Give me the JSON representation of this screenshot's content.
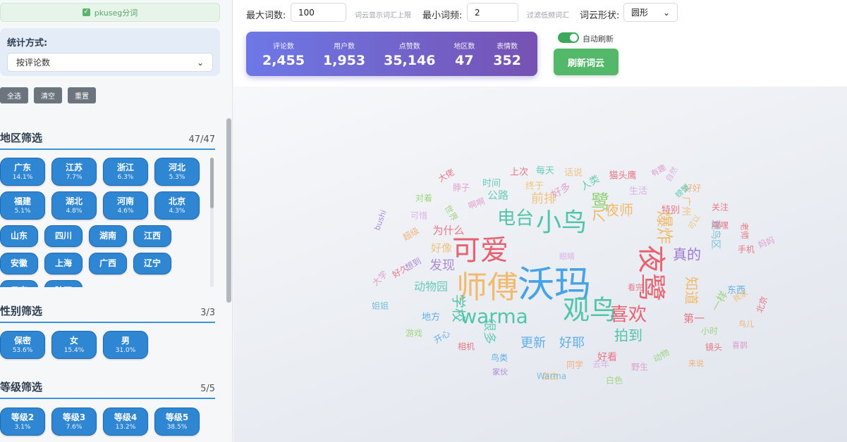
{
  "sidebar": {
    "segmenter_label": "pkuseg分词",
    "stat_label": "统计方式:",
    "stat_value": "按评论数",
    "buttons": {
      "select_all": "全选",
      "clear": "清空",
      "reset": "重置"
    },
    "region": {
      "title": "地区筛选",
      "count": "47/47",
      "items": [
        {
          "name": "广东",
          "pct": "14.1%"
        },
        {
          "name": "江苏",
          "pct": "7.7%"
        },
        {
          "name": "浙江",
          "pct": "6.3%"
        },
        {
          "name": "河北",
          "pct": "5.3%"
        },
        {
          "name": "福建",
          "pct": "5.1%"
        },
        {
          "name": "湖北",
          "pct": "4.8%"
        },
        {
          "name": "河南",
          "pct": "4.6%"
        },
        {
          "name": "北京",
          "pct": "4.3%"
        }
      ],
      "simple_items": [
        "山东",
        "四川",
        "湖南",
        "江西",
        "安徽",
        "上海",
        "广西",
        "辽宁",
        "云南",
        "陕西"
      ]
    },
    "gender": {
      "title": "性别筛选",
      "count": "3/3",
      "items": [
        {
          "name": "保密",
          "pct": "53.6%"
        },
        {
          "name": "女",
          "pct": "15.4%"
        },
        {
          "name": "男",
          "pct": "31.0%"
        }
      ]
    },
    "level": {
      "title": "等级筛选",
      "count": "5/5",
      "items": [
        {
          "name": "等级2",
          "pct": "3.1%"
        },
        {
          "name": "等级3",
          "pct": "7.6%"
        },
        {
          "name": "等级4",
          "pct": "13.2%"
        },
        {
          "name": "等级5",
          "pct": "38.5%"
        }
      ]
    }
  },
  "controls": {
    "max_words_label": "最大词数:",
    "max_words_value": "100",
    "max_words_hint": "词云显示词汇上限",
    "min_freq_label": "最小词频:",
    "min_freq_value": "2",
    "min_freq_hint": "过滤低频词汇",
    "shape_label": "词云形状:",
    "shape_value": "圆形",
    "auto_refresh_label": "自动刷新",
    "refresh_button": "刷新词云"
  },
  "stats": [
    {
      "label": "评论数",
      "value": "2,455"
    },
    {
      "label": "用户数",
      "value": "1,953"
    },
    {
      "label": "点赞数",
      "value": "35,146"
    },
    {
      "label": "地区数",
      "value": "47"
    },
    {
      "label": "表情数",
      "value": "352"
    }
  ],
  "colors": {
    "accent_blue": "#2f86d2",
    "green": "#53b86a",
    "cloud_palette": [
      "#e85a6a",
      "#3ea0e8",
      "#48c3a8",
      "#9b72d0",
      "#e08bc7",
      "#f2b866",
      "#8fcf6a",
      "#5fb7d9",
      "#d9a3e6",
      "#f4a261"
    ]
  },
  "wordcloud": [
    {
      "text": "沃玛",
      "size": 52,
      "c": 1
    },
    {
      "text": "师傅",
      "size": 44,
      "c": 5
    },
    {
      "text": "可爱",
      "size": 40,
      "c": 0
    },
    {
      "text": "夜鹭",
      "size": 40,
      "c": 0
    },
    {
      "text": "观鸟",
      "size": 38,
      "c": 2
    },
    {
      "text": "小鸟",
      "size": 36,
      "c": 2
    },
    {
      "text": "warma",
      "size": 28,
      "c": 2
    },
    {
      "text": "喜欢",
      "size": 26,
      "c": 0
    },
    {
      "text": "电台",
      "size": 26,
      "c": 2
    },
    {
      "text": "爆炸",
      "size": 24,
      "c": 5
    },
    {
      "text": "个",
      "size": 24,
      "c": 5
    },
    {
      "text": "鹭",
      "size": 26,
      "c": 6
    },
    {
      "text": "夜师",
      "size": 20,
      "c": 5
    },
    {
      "text": "真的",
      "size": 20,
      "c": 3
    },
    {
      "text": "知道",
      "size": 20,
      "c": 5
    },
    {
      "text": "前排",
      "size": 18,
      "c": 5
    },
    {
      "text": "发现",
      "size": 18,
      "c": 3
    },
    {
      "text": "学校",
      "size": 20,
      "c": 2
    },
    {
      "text": "拍到",
      "size": 20,
      "c": 2
    },
    {
      "text": "很多",
      "size": 18,
      "c": 2
    },
    {
      "text": "更新",
      "size": 18,
      "c": 1
    },
    {
      "text": "好耶",
      "size": 18,
      "c": 1
    },
    {
      "text": "动物园",
      "size": 16,
      "c": 2
    },
    {
      "text": "好像",
      "size": 15,
      "c": 5
    },
    {
      "text": "为什么",
      "size": 15,
      "c": 0
    },
    {
      "text": "公路",
      "size": 15,
      "c": 2
    },
    {
      "text": "第一",
      "size": 15,
      "c": 0
    },
    {
      "text": "一样",
      "size": 15,
      "c": 6
    },
    {
      "text": "观鸟区",
      "size": 14,
      "c": 7
    },
    {
      "text": "广州",
      "size": 14,
      "c": 5
    },
    {
      "text": "好看",
      "size": 14,
      "c": 0
    },
    {
      "text": "时间",
      "size": 13,
      "c": 2
    },
    {
      "text": "上次",
      "size": 13,
      "c": 0
    },
    {
      "text": "每天",
      "size": 13,
      "c": 2
    },
    {
      "text": "话说",
      "size": 13,
      "c": 5
    },
    {
      "text": "人类",
      "size": 14,
      "c": 2
    },
    {
      "text": "好多",
      "size": 14,
      "c": 4
    },
    {
      "text": "终于",
      "size": 13,
      "c": 5
    },
    {
      "text": "猫头鹰",
      "size": 13,
      "c": 0
    },
    {
      "text": "生活",
      "size": 13,
      "c": 8
    },
    {
      "text": "特别",
      "size": 13,
      "c": 0
    },
    {
      "text": "关注",
      "size": 12,
      "c": 0
    },
    {
      "text": "嘿嘿",
      "size": 12,
      "c": 0
    },
    {
      "text": "手机",
      "size": 12,
      "c": 0
    },
    {
      "text": "东西",
      "size": 13,
      "c": 1
    },
    {
      "text": "北京",
      "size": 12,
      "c": 0
    },
    {
      "text": "看完",
      "size": 11,
      "c": 0
    },
    {
      "text": "地方",
      "size": 13,
      "c": 1
    },
    {
      "text": "开心",
      "size": 12,
      "c": 1
    },
    {
      "text": "游戏",
      "size": 12,
      "c": 6
    },
    {
      "text": "相机",
      "size": 12,
      "c": 0
    },
    {
      "text": "鸟类",
      "size": 12,
      "c": 1
    },
    {
      "text": "同学",
      "size": 12,
      "c": 9
    },
    {
      "text": "去年",
      "size": 12,
      "c": 8
    },
    {
      "text": "自由",
      "size": 12,
      "c": 5
    },
    {
      "text": "白色",
      "size": 12,
      "c": 6
    },
    {
      "text": "野生",
      "size": 12,
      "c": 4
    },
    {
      "text": "动物",
      "size": 12,
      "c": 6
    },
    {
      "text": "镜头",
      "size": 12,
      "c": 0
    },
    {
      "text": "小时",
      "size": 12,
      "c": 6
    },
    {
      "text": "Warma",
      "size": 12,
      "c": 7
    },
    {
      "text": "家伙",
      "size": 11,
      "c": 3
    },
    {
      "text": "姐姐",
      "size": 12,
      "c": 7
    },
    {
      "text": "大学",
      "size": 12,
      "c": 4
    },
    {
      "text": "好久",
      "size": 12,
      "c": 0
    },
    {
      "text": "可惜",
      "size": 12,
      "c": 8
    },
    {
      "text": "对着",
      "size": 12,
      "c": 6
    },
    {
      "text": "大佬",
      "size": 12,
      "c": 0
    },
    {
      "text": "脖子",
      "size": 12,
      "c": 4
    },
    {
      "text": "啊啊",
      "size": 12,
      "c": 4
    },
    {
      "text": "世界",
      "size": 12,
      "c": 6
    },
    {
      "text": "超级",
      "size": 12,
      "c": 9
    },
    {
      "text": "bushi",
      "size": 11,
      "c": 3
    },
    {
      "text": "想到",
      "size": 12,
      "c": 3
    },
    {
      "text": "老师",
      "size": 12,
      "c": 0
    },
    {
      "text": "妈妈",
      "size": 12,
      "c": 4
    },
    {
      "text": "好好",
      "size": 12,
      "c": 9
    },
    {
      "text": "自然",
      "size": 11,
      "c": 8
    },
    {
      "text": "有趣",
      "size": 11,
      "c": 4
    },
    {
      "text": "喜鹊",
      "size": 11,
      "c": 4
    },
    {
      "text": "眼睛",
      "size": 11,
      "c": 8
    },
    {
      "text": "来说",
      "size": 11,
      "c": 9
    },
    {
      "text": "螃蟹",
      "size": 11,
      "c": 2
    },
    {
      "text": "可以",
      "size": 11,
      "c": 5
    },
    {
      "text": "我家",
      "size": 11,
      "c": 5
    },
    {
      "text": "鸟儿",
      "size": 11,
      "c": 9
    }
  ]
}
